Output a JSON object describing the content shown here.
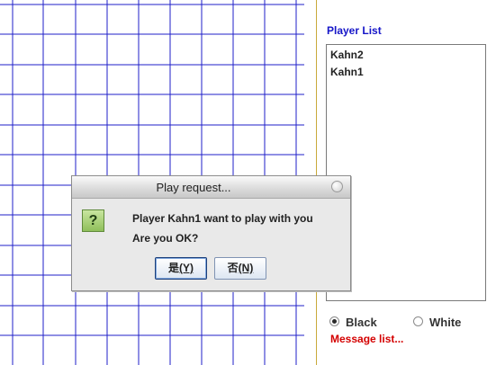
{
  "player_list": {
    "title": "Player List",
    "players": [
      "Kahn2",
      "Kahn1"
    ]
  },
  "color_choice": {
    "options": [
      {
        "label": "Black",
        "selected": true
      },
      {
        "label": "White",
        "selected": false
      }
    ]
  },
  "message_list": {
    "title": "Message list..."
  },
  "dialog": {
    "title": "Play request...",
    "icon": "question-icon",
    "icon_glyph": "?",
    "message_line1": "Player Kahn1 want to play with you",
    "message_line2": "Are you OK?",
    "yes_button": {
      "text": "是",
      "mnemonic": "(Y)"
    },
    "no_button": {
      "text": "否",
      "mnemonic": "(N)"
    }
  },
  "colors": {
    "grid_line": "#1f1fc8",
    "divider": "#c9a93a",
    "player_title": "#1515c8",
    "message_title": "#d40000"
  }
}
